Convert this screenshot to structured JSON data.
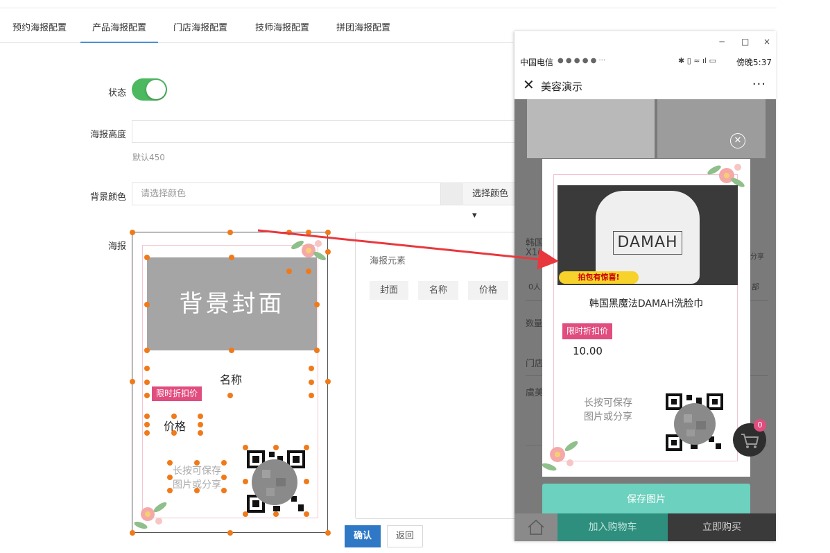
{
  "tabs": [
    {
      "label": "预约海报配置",
      "active": false
    },
    {
      "label": "产品海报配置",
      "active": true
    },
    {
      "label": "门店海报配置",
      "active": false
    },
    {
      "label": "技师海报配置",
      "active": false
    },
    {
      "label": "拼团海报配置",
      "active": false
    }
  ],
  "form": {
    "status_label": "状态",
    "status_on": true,
    "height_label": "海报高度",
    "height_value": "",
    "height_hint": "默认450",
    "bg_color_label": "背景颜色",
    "bg_color_placeholder": "请选择颜色",
    "bg_color_button": "选择颜色",
    "poster_label": "海报"
  },
  "editor": {
    "cover_text": "背景封面",
    "name_text": "名称",
    "badge_text": "限时折扣价",
    "price_text": "价格",
    "save_line1": "长按可保存",
    "save_line2": "图片或分享"
  },
  "elements_panel": {
    "title": "海报元素",
    "chips": [
      "封面",
      "名称",
      "价格"
    ]
  },
  "actions": {
    "confirm": "确认",
    "back": "返回"
  },
  "phone": {
    "window_controls": {
      "minimize": "−",
      "maximize": "□",
      "close": "×"
    },
    "status_left": "中国电信",
    "status_right": "傍晚5:37",
    "nav_title": "美容演示",
    "background_fragments": {
      "item_title": "韩国",
      "item_sub": "X1(",
      "sold": "0人",
      "share": "分享",
      "qty": "数量",
      "store": "门店",
      "store_name": "虞美",
      "all": "部"
    },
    "card": {
      "brand_logo": "DAMAH",
      "banner": "拍包有惊喜!",
      "product_name": "韩国黑魔法DAMAH洗脸巾",
      "badge": "限时折扣价",
      "price": "10.00",
      "save_line1": "长按可保存",
      "save_line2": "图片或分享"
    },
    "save_button": "保存图片",
    "cart_count": "0",
    "add_to_cart": "加入购物车",
    "buy_now": "立即购买"
  },
  "colors": {
    "accent_blue": "#2e78c5",
    "toggle_green": "#4cb860",
    "badge_pink": "#e04d7e",
    "save_teal": "#6cd1be",
    "arrow_red": "#e8383d"
  }
}
